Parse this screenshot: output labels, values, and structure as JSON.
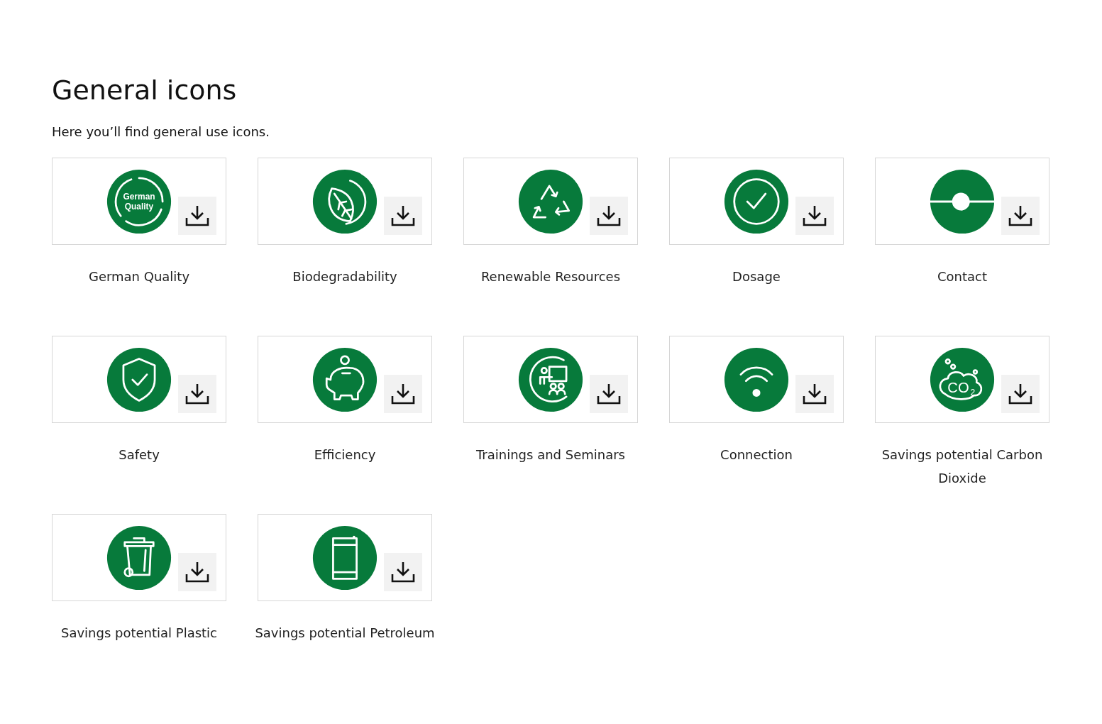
{
  "heading": "General icons",
  "intro": "Here you’ll find general use icons.",
  "icons": [
    {
      "kind": "quality",
      "label": "German Quality",
      "badge_text": [
        "German",
        "Quality"
      ]
    },
    {
      "kind": "leaf",
      "label": "Biodegradability"
    },
    {
      "kind": "recycle",
      "label": "Renewable Resources"
    },
    {
      "kind": "check",
      "label": "Dosage"
    },
    {
      "kind": "contact",
      "label": "Contact"
    },
    {
      "kind": "shield",
      "label": "Safety"
    },
    {
      "kind": "piggy",
      "label": "Efficiency"
    },
    {
      "kind": "training",
      "label": "Trainings and Seminars"
    },
    {
      "kind": "wifi",
      "label": "Connection"
    },
    {
      "kind": "co2",
      "label": "Savings potential Carbon Dioxide",
      "badge_text": [
        "CO",
        "2"
      ]
    },
    {
      "kind": "bin",
      "label": "Savings potential Plastic"
    },
    {
      "kind": "barrel",
      "label": "Savings potential Petroleum"
    }
  ]
}
